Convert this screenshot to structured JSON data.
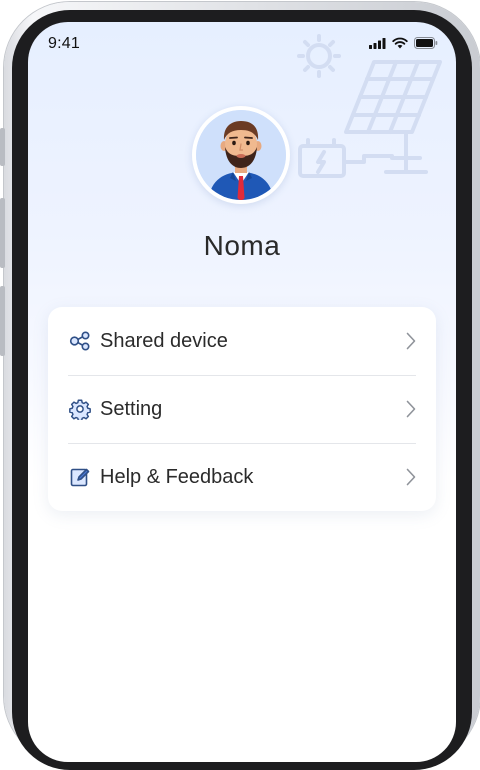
{
  "status_bar": {
    "time": "9:41"
  },
  "profile": {
    "name": "Noma"
  },
  "menu": {
    "items": [
      {
        "label": "Shared device",
        "icon": "share-nodes-icon"
      },
      {
        "label": "Setting",
        "icon": "gear-icon"
      },
      {
        "label": "Help & Feedback",
        "icon": "edit-note-icon"
      }
    ]
  },
  "colors": {
    "accent": "#4a78d6",
    "screen_bg_top": "#e6efff",
    "card_bg": "#ffffff"
  }
}
